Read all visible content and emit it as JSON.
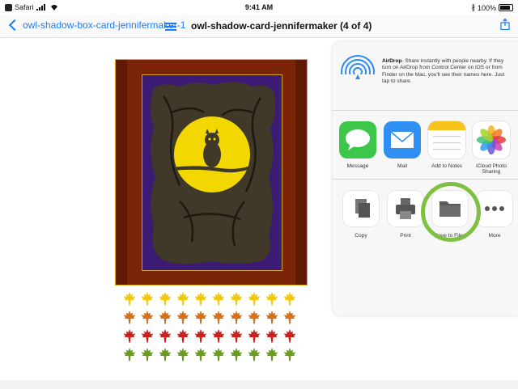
{
  "status_bar": {
    "app_label": "Safari",
    "time": "9:41 AM",
    "battery": "100%"
  },
  "nav": {
    "back_label": "owl-shadow-box-card-jennifermaker-1",
    "title": "owl-shadow-card-jennifermaker (4 of 4)"
  },
  "share_sheet": {
    "airdrop": {
      "title": "AirDrop",
      "description": ". Share instantly with people nearby. If they turn on AirDrop from Control Center on iOS or from Finder on the Mac, you'll see their names here. Just tap to share."
    },
    "apps": [
      {
        "label": "Message",
        "icon": "message-icon"
      },
      {
        "label": "Mail",
        "icon": "mail-icon"
      },
      {
        "label": "Add to Notes",
        "icon": "notes-icon"
      },
      {
        "label": "iCloud Photo Sharing",
        "icon": "photos-icon"
      }
    ],
    "actions": [
      {
        "label": "Copy",
        "icon": "copy-icon"
      },
      {
        "label": "Print",
        "icon": "print-icon"
      },
      {
        "label": "Save to Files",
        "icon": "folder-icon"
      },
      {
        "label": "More",
        "icon": "more-icon"
      }
    ]
  },
  "colors": {
    "ios_blue": "#1b7cf6",
    "highlight_ring": "#7ec042",
    "card_frame": "#7b2408",
    "card_sky": "#3c1b74",
    "moon": "#f2d800",
    "leaf_colors": [
      "#f2c80f",
      "#d2701b",
      "#c8221a",
      "#6a9a1f"
    ]
  }
}
